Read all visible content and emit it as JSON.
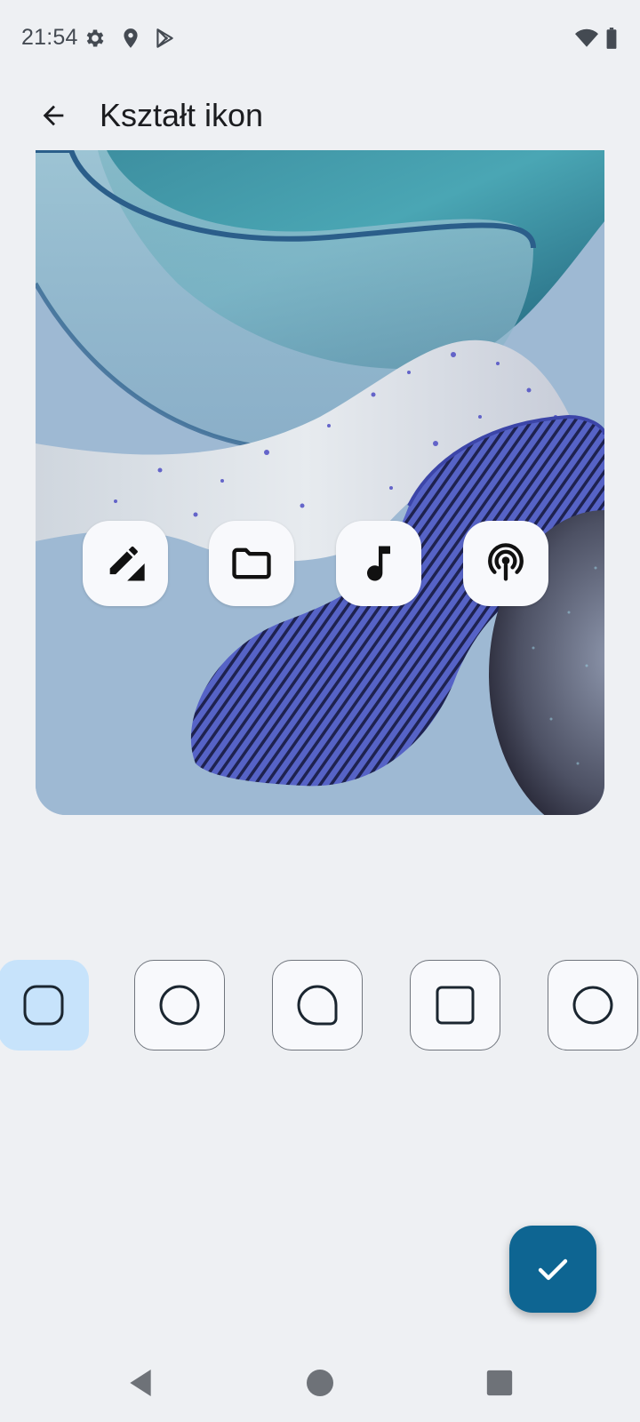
{
  "status_bar": {
    "time": "21:54",
    "left_icons": [
      "gear-icon",
      "location-icon",
      "play-store-icon"
    ],
    "right_icons": [
      "wifi-icon",
      "battery-icon"
    ]
  },
  "app_bar": {
    "back_icon": "arrow-back-icon",
    "title": "Kształt ikon"
  },
  "preview": {
    "icons": [
      "edit-icon",
      "folder-icon",
      "music-note-icon",
      "podcast-icon"
    ]
  },
  "shape_options": [
    {
      "shape": "squircle",
      "selected": true
    },
    {
      "shape": "circle",
      "selected": false
    },
    {
      "shape": "teardrop",
      "selected": false
    },
    {
      "shape": "rounded-square",
      "selected": false
    },
    {
      "shape": "circle-alt",
      "selected": false
    }
  ],
  "fab": {
    "icon": "check-icon"
  },
  "nav_bar": {
    "icons": [
      "nav-back-icon",
      "nav-home-icon",
      "nav-recents-icon"
    ]
  },
  "colors": {
    "background": "#eef0f3",
    "selected_shape": "#c7e3fb",
    "fab": "#0e6592",
    "icon_tile": "#f8f9fc"
  }
}
